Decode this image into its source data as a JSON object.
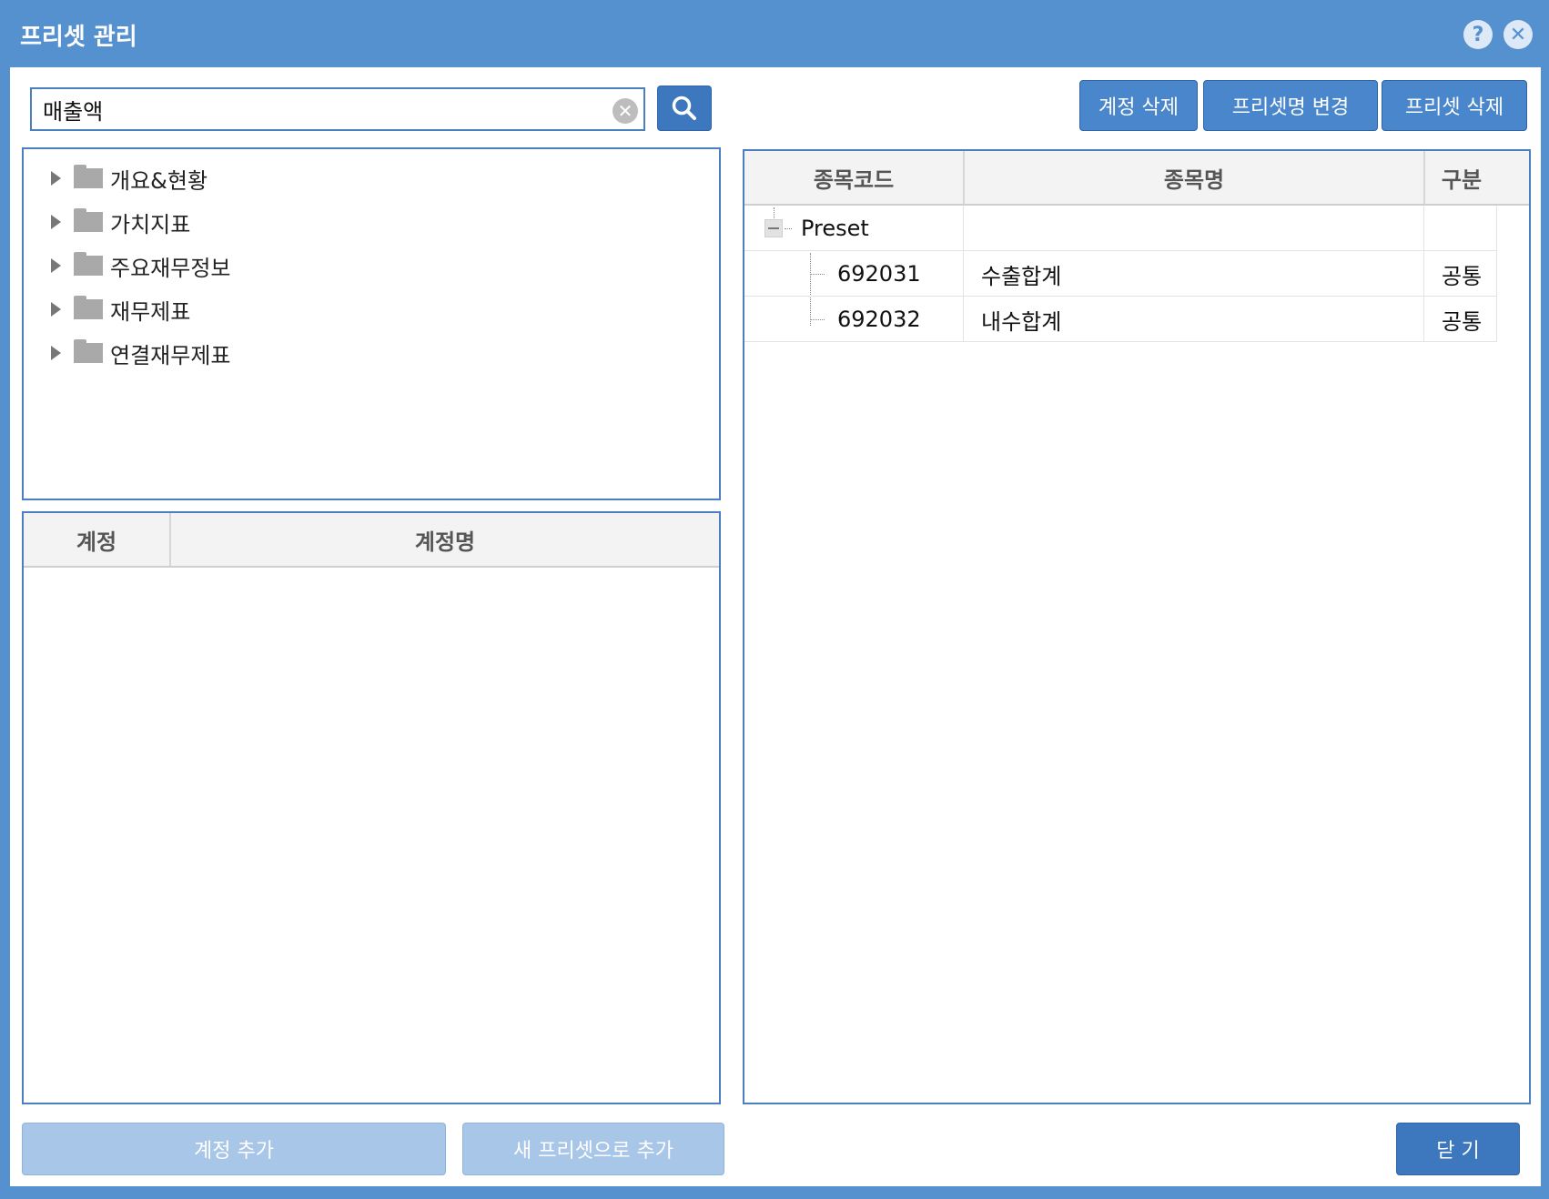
{
  "window": {
    "title": "프리셋 관리",
    "help_icon": "question-icon",
    "close_icon": "close-icon"
  },
  "search": {
    "value": "매출액",
    "clear_icon": "clear-icon",
    "button_icon": "search-icon"
  },
  "toolbar": {
    "delete_account": "계정 삭제",
    "rename_preset": "프리셋명 변경",
    "delete_preset": "프리셋 삭제"
  },
  "tree": {
    "items": [
      {
        "label": "개요&현황"
      },
      {
        "label": "가치지표"
      },
      {
        "label": "주요재무정보"
      },
      {
        "label": "재무제표"
      },
      {
        "label": "연결재무제표"
      }
    ]
  },
  "account_table": {
    "headers": {
      "code": "계정",
      "name": "계정명"
    }
  },
  "preset_table": {
    "headers": {
      "code": "종목코드",
      "name": "종목명",
      "type": "구분"
    },
    "root": {
      "label": "Preset"
    },
    "rows": [
      {
        "code": "692031",
        "name": "수출합계",
        "type": "공통"
      },
      {
        "code": "692032",
        "name": "내수합계",
        "type": "공통"
      }
    ]
  },
  "footer": {
    "add_account": "계정 추가",
    "add_new_preset": "새 프리셋으로 추가",
    "close": "닫 기"
  },
  "colors": {
    "accent": "#5590cf",
    "button": "#3d78bf",
    "disabled": "#a8c6e8"
  }
}
